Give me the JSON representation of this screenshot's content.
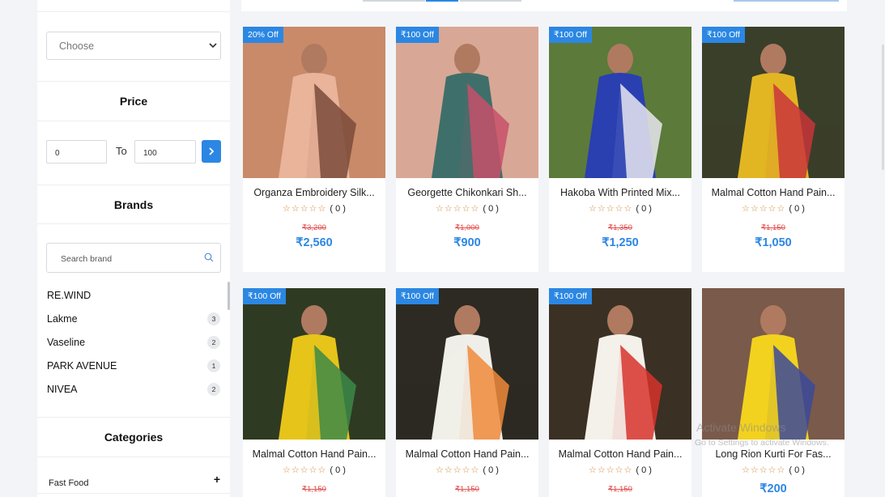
{
  "filters": {
    "select": {
      "placeholder": "Choose"
    },
    "price": {
      "title": "Price",
      "min": "0",
      "to_label": "To",
      "max": "100"
    },
    "brands": {
      "title": "Brands",
      "search_placeholder": "Search brand",
      "items": [
        {
          "name": "RE.WIND",
          "count": ""
        },
        {
          "name": "Lakme",
          "count": "3"
        },
        {
          "name": "Vaseline",
          "count": "2"
        },
        {
          "name": "PARK AVENUE",
          "count": "1"
        },
        {
          "name": "NIVEA",
          "count": "2"
        }
      ]
    },
    "categories": {
      "title": "Categories",
      "items": [
        {
          "name": "Fast Food",
          "toggle": "+"
        }
      ]
    }
  },
  "products": [
    {
      "badge": "20% Off",
      "name": "Organza Embroidery Silk...",
      "stars": "☆☆☆☆☆",
      "reviews": "( 0 )",
      "old_price": "₹3,200",
      "price": "₹2,560",
      "img_colors": [
        "#c98a6a",
        "#e9b49a",
        "#7a4a3a"
      ]
    },
    {
      "badge": "₹100 Off",
      "name": "Georgette Chikonkari Sh...",
      "stars": "☆☆☆☆☆",
      "reviews": "( 0 )",
      "old_price": "₹1,000",
      "price": "₹900",
      "img_colors": [
        "#d9a795",
        "#3f6f6a",
        "#c7506a"
      ]
    },
    {
      "badge": "₹100 Off",
      "name": "Hakoba With Printed Mix...",
      "stars": "☆☆☆☆☆",
      "reviews": "( 0 )",
      "old_price": "₹1,350",
      "price": "₹1,250",
      "img_colors": [
        "#5c7a3a",
        "#2a3fb0",
        "#e8e8f0"
      ]
    },
    {
      "badge": "₹100 Off",
      "name": "Malmal Cotton Hand Pain...",
      "stars": "☆☆☆☆☆",
      "reviews": "( 0 )",
      "old_price": "₹1,150",
      "price": "₹1,050",
      "img_colors": [
        "#3a3f2a",
        "#e2b623",
        "#c9353a"
      ]
    },
    {
      "badge": "₹100 Off",
      "name": "Malmal Cotton Hand Pain...",
      "stars": "☆☆☆☆☆",
      "reviews": "( 0 )",
      "old_price": "₹1,150",
      "price": "",
      "img_colors": [
        "#2f3a22",
        "#e7c41a",
        "#3c8a48"
      ]
    },
    {
      "badge": "₹100 Off",
      "name": "Malmal Cotton Hand Pain...",
      "stars": "☆☆☆☆☆",
      "reviews": "( 0 )",
      "old_price": "₹1,150",
      "price": "",
      "img_colors": [
        "#2c2a22",
        "#f0eee8",
        "#ee8a3a"
      ]
    },
    {
      "badge": "₹100 Off",
      "name": "Malmal Cotton Hand Pain...",
      "stars": "☆☆☆☆☆",
      "reviews": "( 0 )",
      "old_price": "₹1,150",
      "price": "",
      "img_colors": [
        "#3a3124",
        "#f4f0ea",
        "#d6322c"
      ]
    },
    {
      "badge": "",
      "name": "Long Rion Kurti For Fas...",
      "stars": "☆☆☆☆☆",
      "reviews": "( 0 )",
      "old_price": "",
      "price": "₹200",
      "img_colors": [
        "#7a5a4a",
        "#f2d21e",
        "#3b4a9a"
      ]
    }
  ],
  "watermark": {
    "line1": "Activate Windows",
    "line2": "Go to Settings to activate Windows."
  }
}
